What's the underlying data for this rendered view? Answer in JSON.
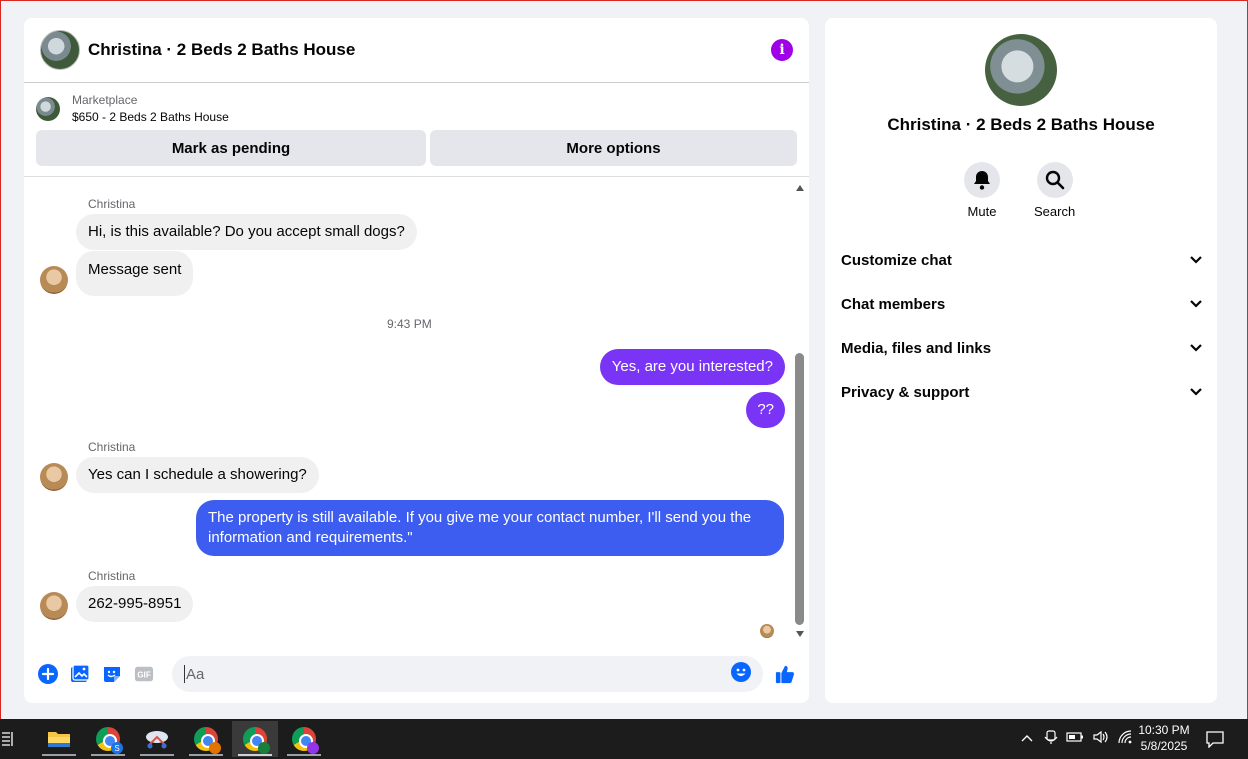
{
  "chat": {
    "title": "Christina · 2 Beds 2 Baths House",
    "marketplace_label": "Marketplace",
    "listing": "$650 - 2 Beds 2 Baths House",
    "actions": {
      "pending": "Mark as pending",
      "more": "More options"
    }
  },
  "messages": {
    "sender1": "Christina",
    "m1": "Hi, is this available? Do you accept small dogs?",
    "m2": "Message sent",
    "time": "9:43 PM",
    "m3": "Yes, are you interested?",
    "m4": "??",
    "sender2": "Christina",
    "m5": "Yes can I schedule a showering?",
    "m6_line1": "The property is still available. If you give me your contact number, I'll send you the",
    "m6_line2": "information and requirements.\"",
    "sender3": "Christina",
    "m7": "262-995-8951"
  },
  "composer": {
    "placeholder": "Aa"
  },
  "side": {
    "title": "Christina · 2 Beds 2 Baths House",
    "mute": "Mute",
    "search": "Search",
    "items": [
      "Customize chat",
      "Chat members",
      "Media, files and links",
      "Privacy & support"
    ]
  },
  "taskbar": {
    "time": "10:30 PM",
    "date": "5/8/2025",
    "badges": [
      "S",
      "",
      "",
      ""
    ]
  },
  "colors": {
    "accent": "#7a34f5",
    "blue_bubble": "#3c5df0",
    "icon_blue": "#0866ff",
    "info": "#a000e5"
  }
}
